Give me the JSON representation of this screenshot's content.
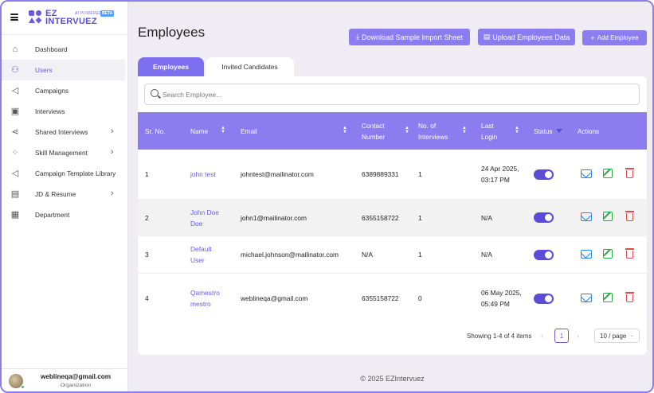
{
  "brand": {
    "line1": "EZ",
    "line2": "INTERVUEZ",
    "ai": "AI POWERED",
    "beta": "BETA"
  },
  "sidebar": {
    "items": [
      {
        "label": "Dashboard",
        "icon": "home-icon"
      },
      {
        "label": "Users",
        "icon": "users-icon",
        "active": true
      },
      {
        "label": "Campaigns",
        "icon": "megaphone-icon"
      },
      {
        "label": "Interviews",
        "icon": "interview-icon"
      },
      {
        "label": "Shared Interviews",
        "icon": "share-icon",
        "has_submenu": true
      },
      {
        "label": "Skill Management",
        "icon": "skills-icon",
        "has_submenu": true
      },
      {
        "label": "Campaign Template Library",
        "icon": "template-icon"
      },
      {
        "label": "JD & Resume",
        "icon": "document-icon",
        "has_submenu": true
      },
      {
        "label": "Department",
        "icon": "building-icon"
      }
    ],
    "profile": {
      "email": "weblineqa@gmail.com",
      "role": "Organization"
    }
  },
  "header": {
    "title": "Employees",
    "download_label": "Download Sample Import Sheet",
    "upload_label": "Upload Employees Data",
    "add_label": "Add Employee"
  },
  "tabs": [
    {
      "label": "Employees",
      "active": true
    },
    {
      "label": "Invited Candidates",
      "active": false
    }
  ],
  "search": {
    "placeholder": "Search Employee..."
  },
  "table": {
    "columns": {
      "sr": "Sr. No.",
      "name": "Name",
      "email": "Email",
      "contact": "Contact Number",
      "interviews": "No. of Interviews",
      "last_login": "Last Login",
      "status": "Status",
      "actions": "Actions"
    },
    "rows": [
      {
        "sr": "1",
        "name": "john test",
        "email": "johntest@mailinator.com",
        "contact": "6389889331",
        "interviews": "1",
        "last_login": "24 Apr 2025, 03:17 PM",
        "status": true
      },
      {
        "sr": "2",
        "name": "John Doe Doe",
        "email": "john1@mailinator.com",
        "contact": "6355158722",
        "interviews": "1",
        "last_login": "N/A",
        "status": true
      },
      {
        "sr": "3",
        "name": "Default User",
        "email": "michael.johnson@mailinator.com",
        "contact": "N/A",
        "interviews": "1",
        "last_login": "N/A",
        "status": true
      },
      {
        "sr": "4",
        "name": "Qamestro mestro",
        "email": "weblineqa@gmail.com",
        "contact": "6355158722",
        "interviews": "0",
        "last_login": "06 May 2025, 05:49 PM",
        "status": true
      }
    ]
  },
  "pagination": {
    "summary": "Showing 1-4 of 4 items",
    "current_page": "1",
    "page_size": "10 / page"
  },
  "footer": {
    "copyright": "© 2025 EZIntervuez"
  },
  "colors": {
    "accent": "#8b7cf0",
    "accent_dark": "#5b4bd6",
    "mail": "#2e86de",
    "edit": "#27a844",
    "delete": "#e14b4b"
  }
}
